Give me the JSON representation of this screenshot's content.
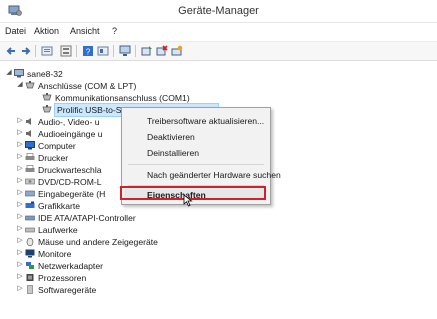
{
  "window": {
    "title": "Geräte-Manager"
  },
  "menu": [
    {
      "label": "Datei"
    },
    {
      "label": "Aktion"
    },
    {
      "label": "Ansicht"
    },
    {
      "label": "?"
    }
  ],
  "toolbar": {
    "icons": [
      "back-arrow-icon",
      "forward-arrow-icon",
      "properties-icon",
      "view-icon",
      "help-icon",
      "scan-icon",
      "monitor-icon",
      "update-driver-icon",
      "uninstall-icon",
      "scan-hardware-icon"
    ]
  },
  "tree": {
    "root": "sane8-32",
    "items": [
      {
        "label": "Anschlüsse (COM & LPT)",
        "expanded": true
      },
      {
        "label": "Kommunikationsanschluss (COM1)"
      },
      {
        "label": "Prolific USB-to-Serial Comm Port (COM3)",
        "selected": true
      },
      {
        "label": "Audio-, Video- u"
      },
      {
        "label": "Audioeingänge u"
      },
      {
        "label": "Computer"
      },
      {
        "label": "Drucker"
      },
      {
        "label": "Druckwarteschla"
      },
      {
        "label": "DVD/CD-ROM-L"
      },
      {
        "label": "Eingabegeräte (H"
      },
      {
        "label": "Grafikkarte"
      },
      {
        "label": "IDE ATA/ATAPI-Controller"
      },
      {
        "label": "Laufwerke"
      },
      {
        "label": "Mäuse und andere Zeigegeräte"
      },
      {
        "label": "Monitore"
      },
      {
        "label": "Netzwerkadapter"
      },
      {
        "label": "Prozessoren"
      },
      {
        "label": "Softwaregeräte"
      }
    ]
  },
  "context_menu": {
    "items": [
      {
        "label": "Treibersoftware aktualisieren..."
      },
      {
        "label": "Deaktivieren"
      },
      {
        "label": "Deinstallieren"
      },
      {
        "label": "Nach geänderter Hardware suchen"
      },
      {
        "label": "Eigenschaften",
        "bold": true
      }
    ]
  },
  "colors": {
    "highlight_box": "#d0202a",
    "selection": "#cce8ff"
  }
}
